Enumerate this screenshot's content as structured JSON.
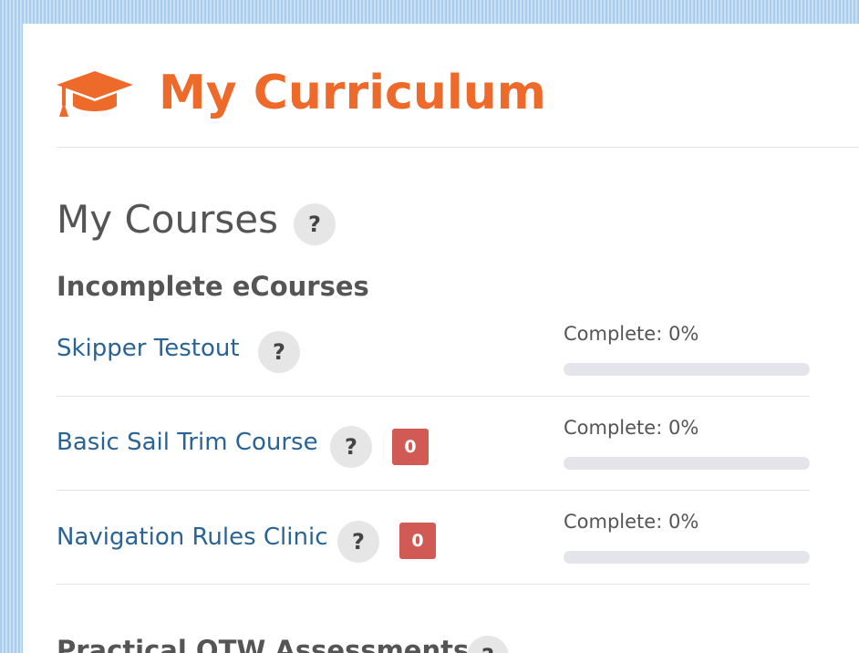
{
  "header": {
    "title": "My Curriculum",
    "icon": "graduation-cap-icon",
    "accent_color": "#ee6a2a"
  },
  "my_courses": {
    "title": "My Courses",
    "help_symbol": "?"
  },
  "incomplete": {
    "title": "Incomplete eCourses",
    "courses": [
      {
        "name": "Skipper Testout",
        "help_symbol": "?",
        "badge": null,
        "progress_label": "Complete: 0%",
        "progress": 0
      },
      {
        "name": "Basic Sail Trim Course",
        "help_symbol": "?",
        "badge": "0",
        "progress_label": "Complete: 0%",
        "progress": 0
      },
      {
        "name": "Navigation Rules Clinic",
        "help_symbol": "?",
        "badge": "0",
        "progress_label": "Complete: 0%",
        "progress": 0
      }
    ]
  },
  "next_section": {
    "title": "Practical OTW Assessments",
    "help_symbol": "?"
  },
  "colors": {
    "link": "#2a6496",
    "badge": "#d15b54",
    "progress_track": "#e4e5ea"
  }
}
